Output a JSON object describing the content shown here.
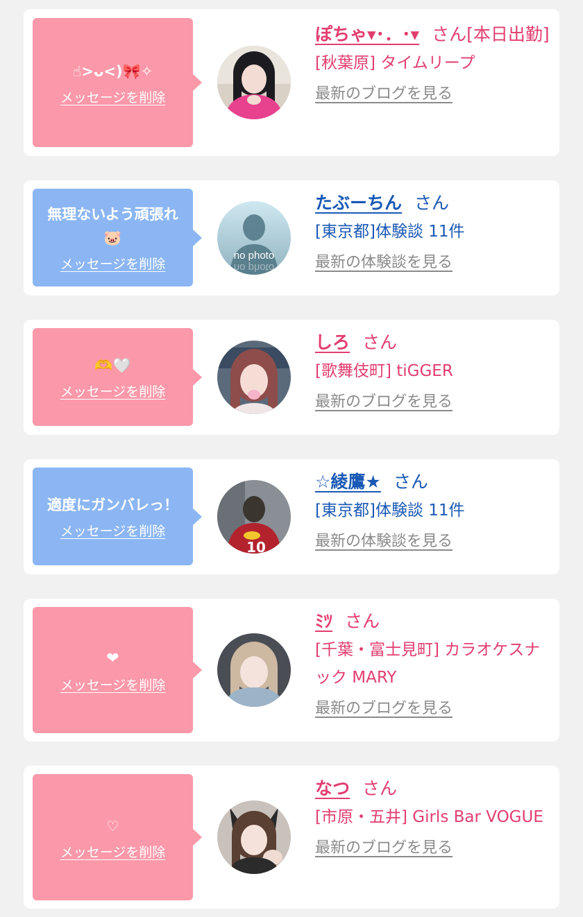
{
  "items": [
    {
      "message": "☝︎>ᴗ<)🎀✧",
      "delete_label": "メッセージを削除",
      "name": "ぽちゃ▾･．･▾",
      "suffix": "さん[本日出勤]",
      "detail": "[秋葉原] タイムリープ",
      "link": "最新のブログを見る",
      "theme": "pink"
    },
    {
      "message": "無理ないよう頑張れ🐷",
      "delete_label": "メッセージを削除",
      "name": "たぶーちん",
      "suffix": "さん",
      "detail": "[東京都]体験談 11件",
      "link": "最新の体験談を見る",
      "theme": "blue",
      "avatar_text": "no photo"
    },
    {
      "message": "🫶🤍",
      "delete_label": "メッセージを削除",
      "name": "しろ",
      "suffix": "さん",
      "detail": "[歌舞伎町] tiGGER",
      "link": "最新のブログを見る",
      "theme": "pink"
    },
    {
      "message": "適度にガンバレっ！",
      "delete_label": "メッセージを削除",
      "name": "☆綾鷹★",
      "suffix": "さん",
      "detail": "[東京都]体験談 11件",
      "link": "最新の体験談を見る",
      "theme": "blue"
    },
    {
      "message": "❤",
      "delete_label": "メッセージを削除",
      "name": "ﾐﾂ",
      "suffix": "さん",
      "detail": "[千葉・富士見町] カラオケスナック MARY",
      "link": "最新のブログを見る",
      "theme": "pink"
    },
    {
      "message": "♡",
      "delete_label": "メッセージを削除",
      "name": "なつ",
      "suffix": "さん",
      "detail": "[市原・五井] Girls Bar VOGUE",
      "link": "最新のブログを見る",
      "theme": "pink"
    }
  ],
  "colors": {
    "page_bg": "#f1f1f1",
    "card_bg": "#ffffff",
    "pink_bubble": "#fb98a9",
    "blue_bubble": "#8bb6f3",
    "pink_text": "#e23d6f",
    "blue_text": "#1a59b5",
    "link_gray": "#8a8a8a"
  }
}
